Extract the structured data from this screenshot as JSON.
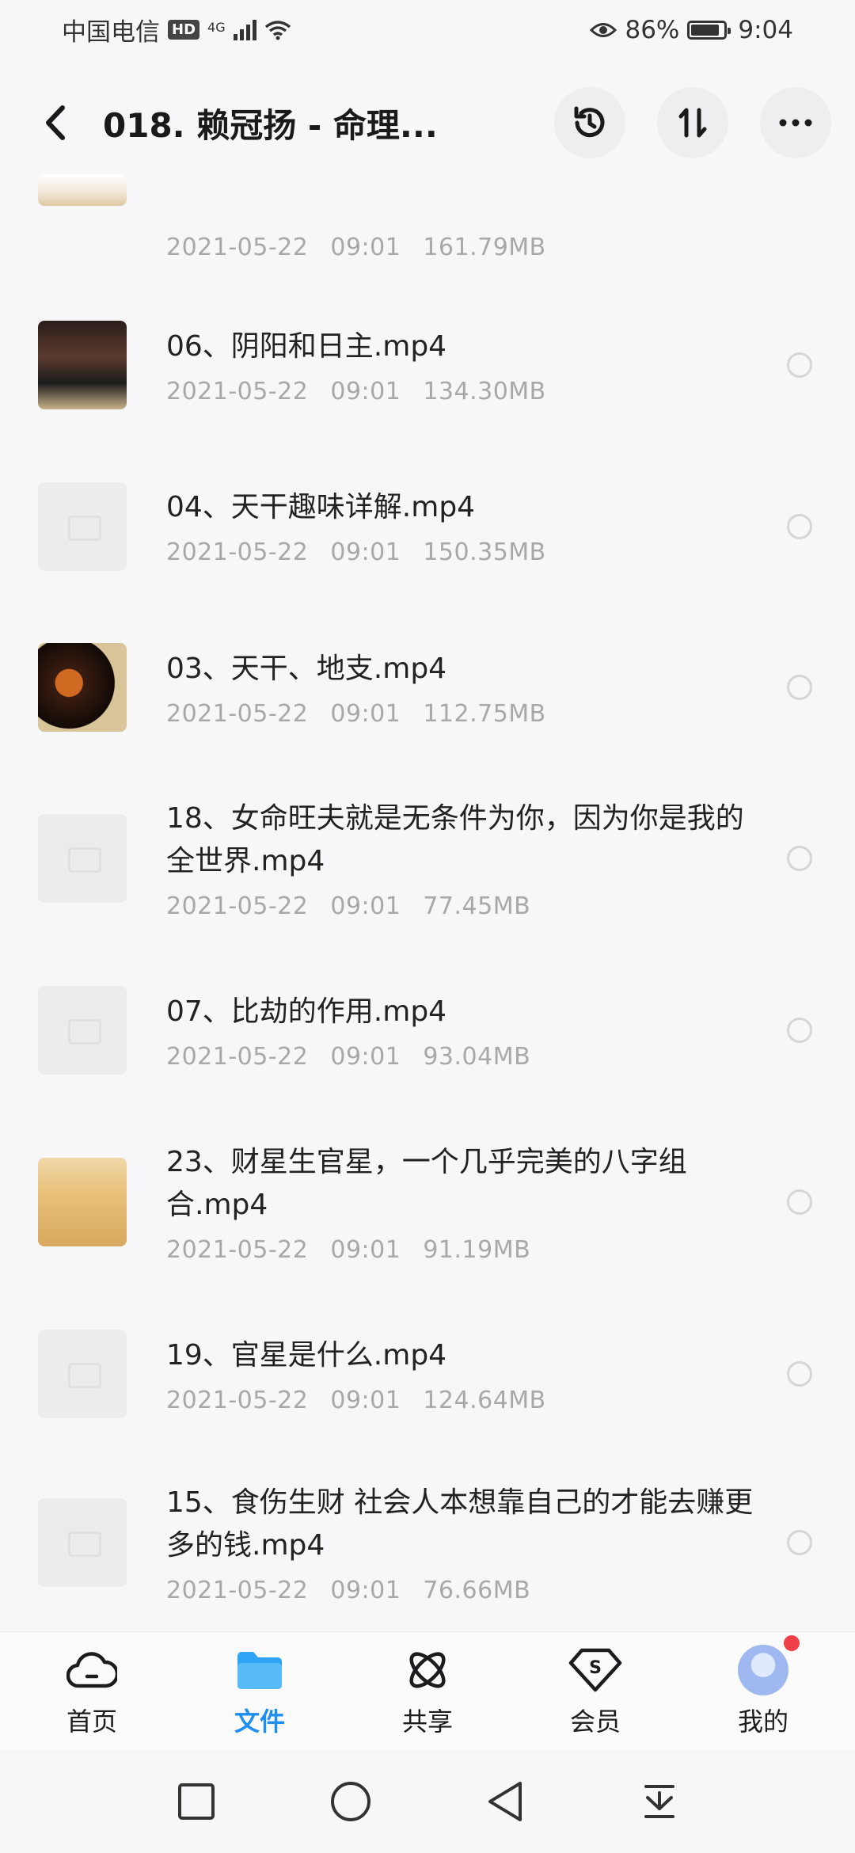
{
  "status_bar": {
    "carrier": "中国电信",
    "hd": "HD",
    "network": "4G",
    "battery": "86%",
    "time": "9:04"
  },
  "header": {
    "title": "018. 赖冠扬 - 命理...",
    "icons": [
      "back-icon",
      "history-icon",
      "sort-icon",
      "more-icon"
    ]
  },
  "files": [
    {
      "name": "",
      "date": "2021-05-22",
      "time": "09:01",
      "size": "161.79MB",
      "thumb": "img-top"
    },
    {
      "name": "06、阴阳和日主.mp4",
      "date": "2021-05-22",
      "time": "09:01",
      "size": "134.30MB",
      "thumb": "img-a"
    },
    {
      "name": "04、天干趣味详解.mp4",
      "date": "2021-05-22",
      "time": "09:01",
      "size": "150.35MB",
      "thumb": "generic"
    },
    {
      "name": "03、天干、地支.mp4",
      "date": "2021-05-22",
      "time": "09:01",
      "size": "112.75MB",
      "thumb": "img-b"
    },
    {
      "name": "18、女命旺夫就是无条件为你，因为你是我的全世界.mp4",
      "date": "2021-05-22",
      "time": "09:01",
      "size": "77.45MB",
      "thumb": "generic"
    },
    {
      "name": "07、比劫的作用.mp4",
      "date": "2021-05-22",
      "time": "09:01",
      "size": "93.04MB",
      "thumb": "generic"
    },
    {
      "name": "23、财星生官星，一个几乎完美的八字组合.mp4",
      "date": "2021-05-22",
      "time": "09:01",
      "size": "91.19MB",
      "thumb": "img-c"
    },
    {
      "name": "19、官星是什么.mp4",
      "date": "2021-05-22",
      "time": "09:01",
      "size": "124.64MB",
      "thumb": "generic"
    },
    {
      "name": "15、食伤生财 社会人本想靠自己的才能去赚更多的钱.mp4",
      "date": "2021-05-22",
      "time": "09:01",
      "size": "76.66MB",
      "thumb": "generic"
    }
  ],
  "tabs": [
    {
      "label": "首页",
      "icon": "cloud-icon",
      "active": false
    },
    {
      "label": "文件",
      "icon": "folder-icon",
      "active": true
    },
    {
      "label": "共享",
      "icon": "share-icon",
      "active": false
    },
    {
      "label": "会员",
      "icon": "vip-icon",
      "active": false
    },
    {
      "label": "我的",
      "icon": "avatar",
      "active": false
    }
  ],
  "nav": [
    "square-icon",
    "home-circle-icon",
    "back-triangle-icon",
    "notification-pull-icon"
  ],
  "colors": {
    "accent": "#1e8ef0",
    "badge": "#f2404a",
    "meta_text": "#a8a8ac"
  }
}
